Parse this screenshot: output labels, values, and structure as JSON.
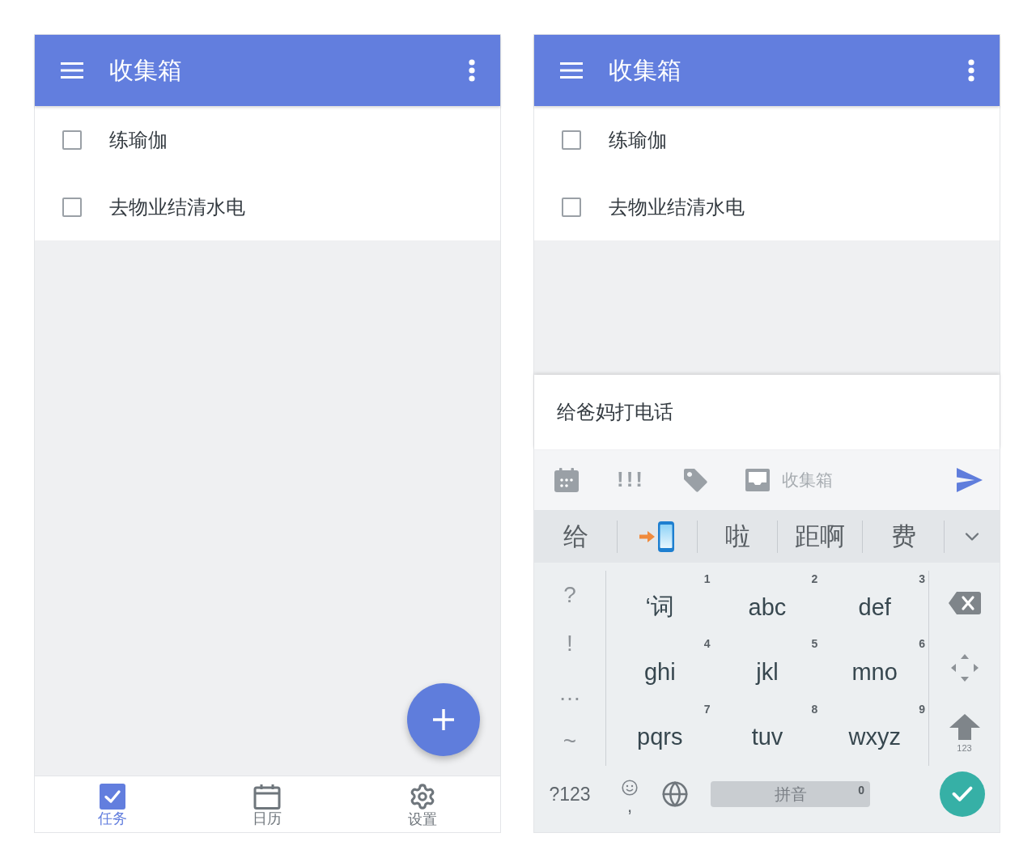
{
  "screens": [
    {
      "app_bar": {
        "title": "收集箱"
      },
      "tasks": [
        {
          "title": "练瑜伽",
          "checked": false
        },
        {
          "title": "去物业结清水电",
          "checked": false
        }
      ],
      "fab": true,
      "bottom_nav": [
        {
          "label": "任务",
          "selected": true
        },
        {
          "label": "日历",
          "selected": false
        },
        {
          "label": "设置",
          "selected": false
        }
      ]
    },
    {
      "app_bar": {
        "title": "收集箱"
      },
      "tasks": [
        {
          "title": "练瑜伽",
          "checked": false
        },
        {
          "title": "去物业结清水电",
          "checked": false
        }
      ],
      "quick_add": {
        "value": "给爸妈打电话",
        "priority": "!!!",
        "project": "收集箱"
      },
      "keyboard": {
        "candidates": [
          {
            "kind": "text",
            "text": "给"
          },
          {
            "kind": "emoji"
          },
          {
            "kind": "text",
            "text": "啦"
          },
          {
            "kind": "text",
            "text": "距啊"
          },
          {
            "kind": "text",
            "text": "费"
          }
        ],
        "symbols": [
          "?",
          "!",
          "…",
          "~"
        ],
        "keys": [
          {
            "letters": "‘词",
            "number": "1"
          },
          {
            "letters": "abc",
            "number": "2"
          },
          {
            "letters": "def",
            "number": "3"
          },
          {
            "letters": "ghi",
            "number": "4"
          },
          {
            "letters": "jkl",
            "number": "5"
          },
          {
            "letters": "mno",
            "number": "6"
          },
          {
            "letters": "pqrs",
            "number": "7"
          },
          {
            "letters": "tuv",
            "number": "8"
          },
          {
            "letters": "wxyz",
            "number": "9"
          }
        ],
        "shift_hint": "123",
        "mode_key": "?123",
        "comma": ",",
        "space_label": "拼音",
        "space_hint": "0"
      }
    }
  ]
}
